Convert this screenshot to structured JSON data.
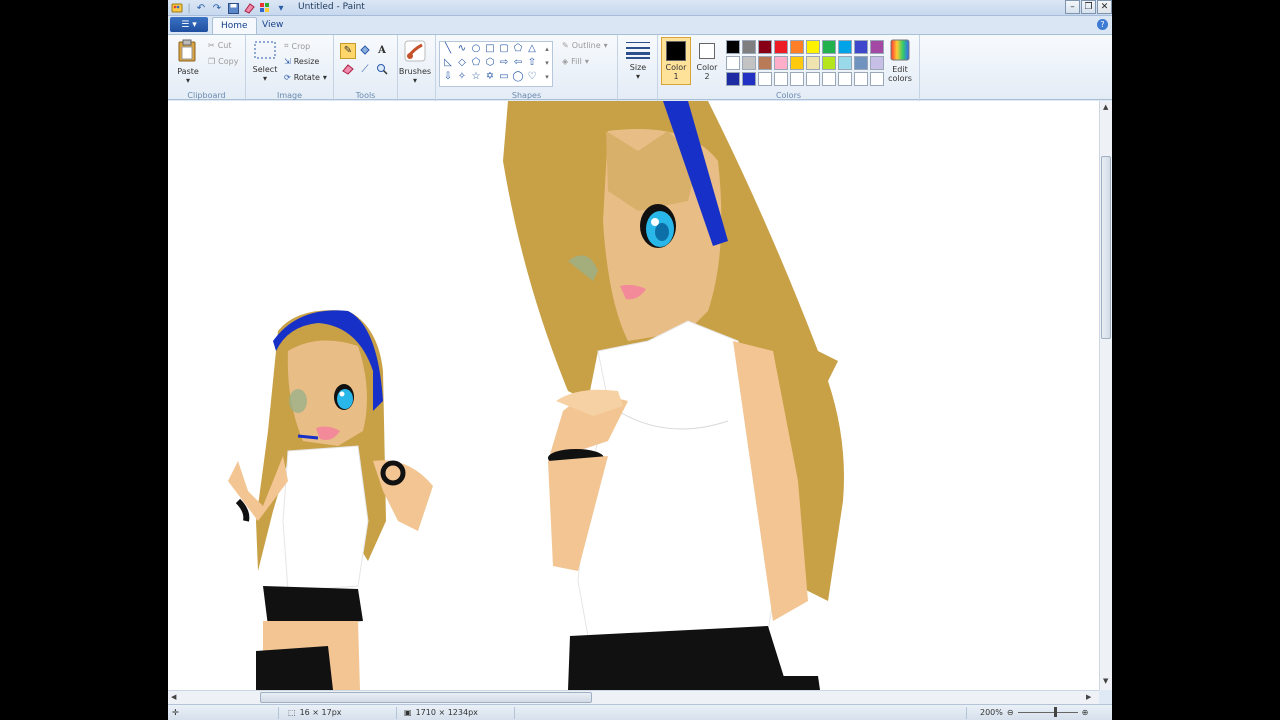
{
  "window": {
    "title": "Untitled - Paint"
  },
  "title_controls": {
    "minimize": "–",
    "restore": "❐",
    "close": "✕"
  },
  "tabs": [
    {
      "label": "Home"
    },
    {
      "label": "View"
    }
  ],
  "file_menu_icon": "paint-menu-icon",
  "help_glyph": "?",
  "ribbon": {
    "clipboard": {
      "group_label": "Clipboard",
      "paste": "Paste",
      "cut": "Cut",
      "copy": "Copy"
    },
    "image": {
      "group_label": "Image",
      "select": "Select",
      "crop": "Crop",
      "resize": "Resize",
      "rotate": "Rotate"
    },
    "tools": {
      "group_label": "Tools"
    },
    "brushes": {
      "label": "Brushes"
    },
    "shapes": {
      "group_label": "Shapes",
      "outline": "Outline",
      "fill": "Fill"
    },
    "size": {
      "label": "Size"
    },
    "colors": {
      "group_label": "Colors",
      "color1_label": "Color",
      "color1_num": "1",
      "color2_label": "Color",
      "color2_num": "2",
      "color1_value": "#000000",
      "color2_value": "#ffffff",
      "edit_label": "Edit",
      "edit_label2": "colors",
      "palette": [
        "#000000",
        "#7f7f7f",
        "#880015",
        "#ed1c24",
        "#ff7f27",
        "#fff200",
        "#22b14c",
        "#00a2e8",
        "#3f48cc",
        "#a349a4",
        "#ffffff",
        "#c3c3c3",
        "#b97a57",
        "#ffaec9",
        "#ffc90e",
        "#efe4b0",
        "#b5e61d",
        "#99d9ea",
        "#7092be",
        "#c8bfe7",
        "#1d2ca3",
        "#2230c4",
        "#ffffff",
        "#ffffff",
        "#ffffff",
        "#ffffff",
        "#ffffff",
        "#ffffff",
        "#ffffff",
        "#ffffff"
      ]
    }
  },
  "status": {
    "selection_size": "16 × 17px",
    "image_size": "1710 × 1234px",
    "zoom": "200%"
  }
}
